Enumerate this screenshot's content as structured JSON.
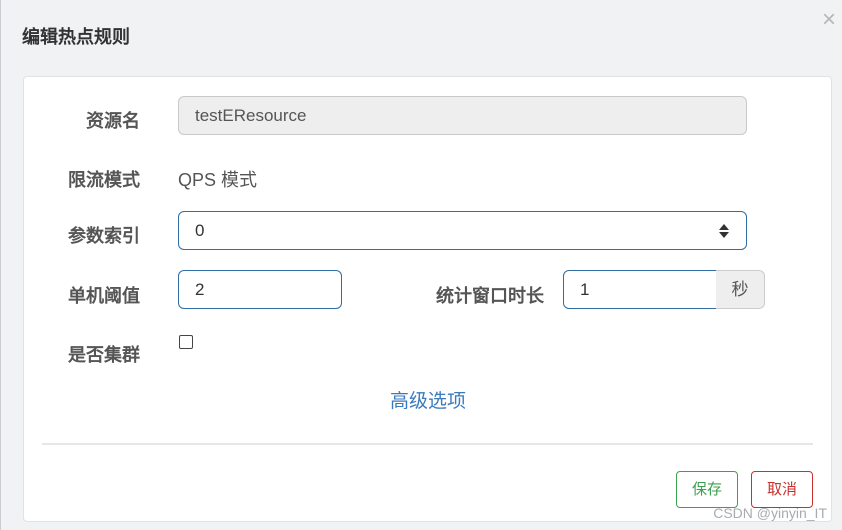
{
  "dialog": {
    "title": "编辑热点规则",
    "close_glyph": "×"
  },
  "form": {
    "resource_name": {
      "label": "资源名",
      "value": "testEResource"
    },
    "limit_mode": {
      "label": "限流模式",
      "value": "QPS 模式"
    },
    "param_index": {
      "label": "参数索引",
      "value": "0"
    },
    "threshold": {
      "label": "单机阈值",
      "value": "2"
    },
    "window": {
      "label": "统计窗口时长",
      "value": "1",
      "unit": "秒"
    },
    "cluster": {
      "label": "是否集群",
      "checked": false
    },
    "advanced_link": "高级选项"
  },
  "footer": {
    "save_label": "保存",
    "cancel_label": "取消"
  },
  "watermark": "CSDN @yinyin_IT",
  "colors": {
    "input_border": "#2f6da3",
    "link": "#3a7abd",
    "save": "#3ca14d",
    "cancel": "#c9302c"
  }
}
